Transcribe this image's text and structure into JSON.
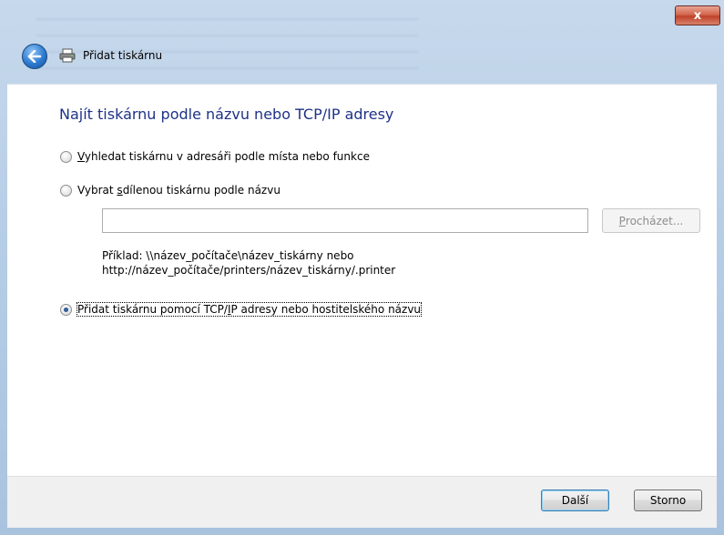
{
  "window": {
    "close_label": "x",
    "title": "Přidat tiskárnu"
  },
  "page": {
    "heading": "Najít tiskárnu podle názvu nebo TCP/IP adresy"
  },
  "options": [
    {
      "accel": "V",
      "label_rest": "yhledat tiskárnu v adresáři podle místa nebo funkce",
      "selected": false
    },
    {
      "label_pre": "Vybrat ",
      "accel": "s",
      "label_rest": "dílenou tiskárnu podle názvu",
      "selected": false
    },
    {
      "label_pre": "Přidat tiskárnu pomocí TCP/",
      "accel": "I",
      "label_rest": "P adresy nebo hostitelského názvu",
      "selected": true
    }
  ],
  "shared_printer_input": {
    "value": ""
  },
  "browse_button": {
    "accel": "P",
    "label_rest": "rocházet..."
  },
  "example": {
    "line1": "Příklad: \\\\název_počítače\\název_tiskárny nebo",
    "line2": "http://název_počítače/printers/název_tiskárny/.printer"
  },
  "buttons": {
    "next": "Další",
    "cancel": "Storno"
  },
  "colors": {
    "heading": "#1e3287",
    "frame": "#b6cde6",
    "close": "#c0412a"
  },
  "icons": [
    "close-icon",
    "back-arrow-icon",
    "printer-icon"
  ]
}
